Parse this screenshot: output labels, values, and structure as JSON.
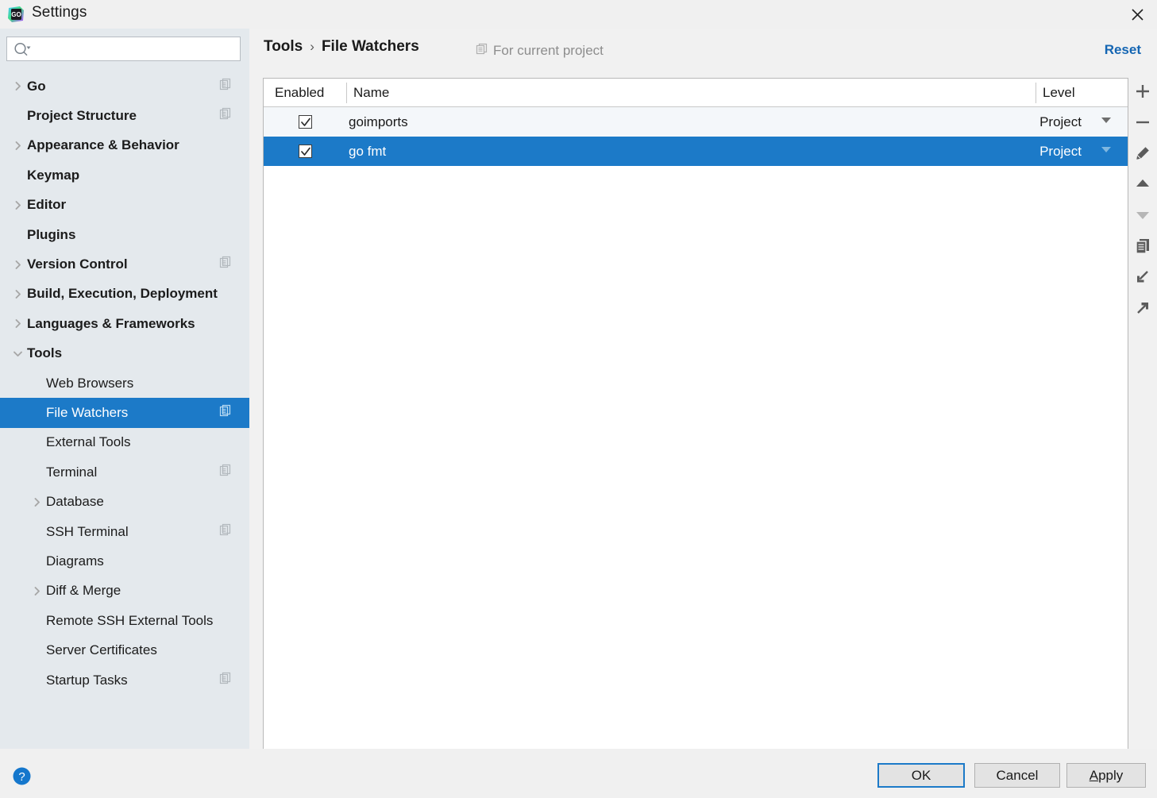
{
  "window": {
    "title": "Settings",
    "app_icon": "goland-icon",
    "close_icon": "close-icon"
  },
  "sidebar": {
    "search": {
      "placeholder": "",
      "value": "",
      "icon": "search-icon"
    },
    "items": [
      {
        "label": "Go",
        "level": 0,
        "arrow": "collapsed",
        "badge": true,
        "selected": false
      },
      {
        "label": "Project Structure",
        "level": 0,
        "arrow": "none",
        "badge": true,
        "selected": false
      },
      {
        "label": "Appearance & Behavior",
        "level": 0,
        "arrow": "collapsed",
        "badge": false,
        "selected": false
      },
      {
        "label": "Keymap",
        "level": 0,
        "arrow": "none",
        "badge": false,
        "selected": false
      },
      {
        "label": "Editor",
        "level": 0,
        "arrow": "collapsed",
        "badge": false,
        "selected": false
      },
      {
        "label": "Plugins",
        "level": 0,
        "arrow": "none",
        "badge": false,
        "selected": false
      },
      {
        "label": "Version Control",
        "level": 0,
        "arrow": "collapsed",
        "badge": true,
        "selected": false
      },
      {
        "label": "Build, Execution, Deployment",
        "level": 0,
        "arrow": "collapsed",
        "badge": false,
        "selected": false
      },
      {
        "label": "Languages & Frameworks",
        "level": 0,
        "arrow": "collapsed",
        "badge": false,
        "selected": false
      },
      {
        "label": "Tools",
        "level": 0,
        "arrow": "expanded",
        "badge": false,
        "selected": false
      },
      {
        "label": "Web Browsers",
        "level": 1,
        "arrow": "none",
        "badge": false,
        "selected": false
      },
      {
        "label": "File Watchers",
        "level": 1,
        "arrow": "none",
        "badge": true,
        "selected": true
      },
      {
        "label": "External Tools",
        "level": 1,
        "arrow": "none",
        "badge": false,
        "selected": false
      },
      {
        "label": "Terminal",
        "level": 1,
        "arrow": "none",
        "badge": true,
        "selected": false
      },
      {
        "label": "Database",
        "level": 1,
        "arrow": "collapsed",
        "badge": false,
        "selected": false
      },
      {
        "label": "SSH Terminal",
        "level": 1,
        "arrow": "none",
        "badge": true,
        "selected": false
      },
      {
        "label": "Diagrams",
        "level": 1,
        "arrow": "none",
        "badge": false,
        "selected": false
      },
      {
        "label": "Diff & Merge",
        "level": 1,
        "arrow": "collapsed",
        "badge": false,
        "selected": false
      },
      {
        "label": "Remote SSH External Tools",
        "level": 1,
        "arrow": "none",
        "badge": false,
        "selected": false
      },
      {
        "label": "Server Certificates",
        "level": 1,
        "arrow": "none",
        "badge": false,
        "selected": false
      },
      {
        "label": "Startup Tasks",
        "level": 1,
        "arrow": "none",
        "badge": true,
        "selected": false
      }
    ]
  },
  "main": {
    "breadcrumb": {
      "parent": "Tools",
      "separator": "›",
      "current": "File Watchers"
    },
    "scope_note": {
      "icon": "project-scope-icon",
      "text": "For current project"
    },
    "reset_label": "Reset",
    "table": {
      "columns": [
        "Enabled",
        "Name",
        "Level"
      ],
      "rows": [
        {
          "enabled": true,
          "name": "goimports",
          "level": "Project",
          "selected": false
        },
        {
          "enabled": true,
          "name": "go fmt",
          "level": "Project",
          "selected": true
        }
      ]
    },
    "toolbar": [
      {
        "name": "add-button",
        "icon": "plus-icon",
        "enabled": true
      },
      {
        "name": "remove-button",
        "icon": "minus-icon",
        "enabled": true
      },
      {
        "name": "edit-button",
        "icon": "pencil-icon",
        "enabled": true
      },
      {
        "name": "move-up-button",
        "icon": "arrow-up-icon",
        "enabled": true
      },
      {
        "name": "move-down-button",
        "icon": "arrow-down-icon",
        "enabled": false
      },
      {
        "name": "copy-button",
        "icon": "copy-icon",
        "enabled": true
      },
      {
        "name": "import-button",
        "icon": "import-icon",
        "enabled": true
      },
      {
        "name": "export-button",
        "icon": "export-icon",
        "enabled": true
      }
    ]
  },
  "footer": {
    "help_icon": "help-icon",
    "ok_label": "OK",
    "cancel_label": "Cancel",
    "apply_mnemonic": "A",
    "apply_rest": "pply"
  },
  "colors": {
    "selection": "#1c7ac8",
    "link": "#1566b3",
    "sidebar_bg": "#e4e9ed",
    "panel_bg": "#f1f1f1",
    "row_alt": "#f4f7fa"
  }
}
